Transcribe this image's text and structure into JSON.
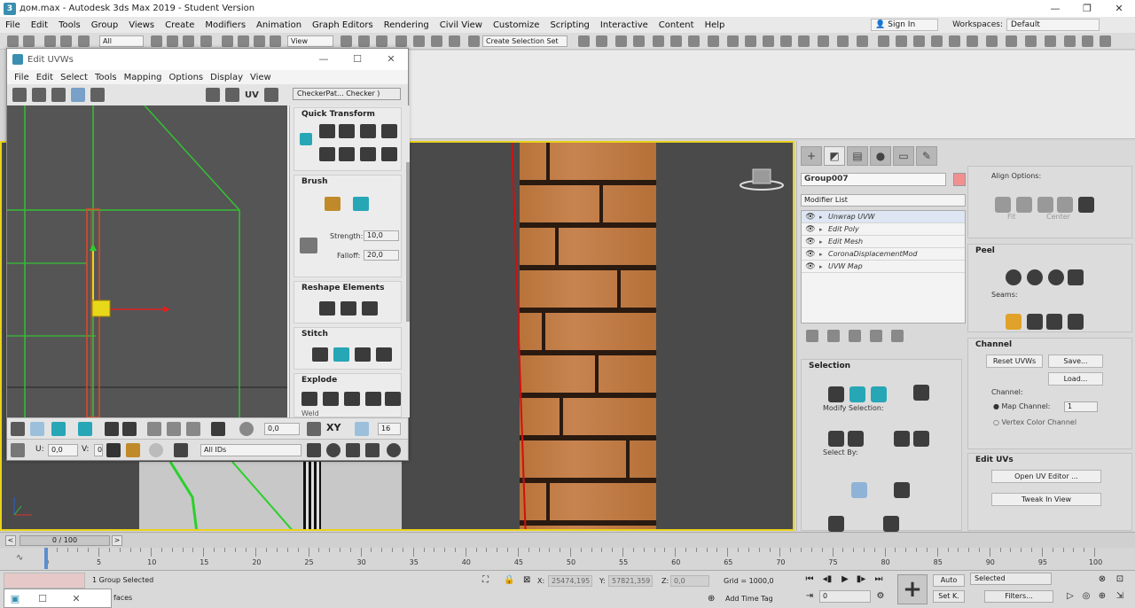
{
  "window": {
    "title": "дом.max - Autodesk 3ds Max 2019 - Student Version",
    "buttons": [
      "—",
      "❐",
      "✕"
    ]
  },
  "menubar": {
    "items": [
      "File",
      "Edit",
      "Tools",
      "Group",
      "Views",
      "Create",
      "Modifiers",
      "Animation",
      "Graph Editors",
      "Rendering",
      "Civil View",
      "Customize",
      "Scripting",
      "Interactive",
      "Content",
      "Help"
    ],
    "sign_in": "Sign In",
    "workspaces_label": "Workspaces:",
    "workspace_value": "Default"
  },
  "maintoolbar": {
    "filter": "All",
    "ref_coord": "View",
    "selection_set": "Create Selection Set"
  },
  "uvw_editor": {
    "title": "Edit UVWs",
    "menu": [
      "File",
      "Edit",
      "Select",
      "Tools",
      "Mapping",
      "Options",
      "Display",
      "View"
    ],
    "uv_label": "UV",
    "checker": "CheckerPat... Checker )",
    "sections": {
      "quick_transform": "Quick Transform",
      "brush": "Brush",
      "strength_label": "Strength:",
      "strength_value": "10,0",
      "falloff_label": "Falloff:",
      "falloff_value": "20,0",
      "reshape": "Reshape Elements",
      "stitch": "Stitch",
      "explode": "Explode",
      "weld": "Weld"
    },
    "bottom": {
      "angle_value": "0,0",
      "xy_label": "XY",
      "grid_value": "16",
      "u_label": "U:",
      "u_value": "0,0",
      "v_label": "V:",
      "v_value": "0",
      "ids": "All IDs"
    }
  },
  "cmdpanel": {
    "object_name": "Group007",
    "modifier_list": "Modifier List",
    "stack": [
      {
        "label": "Unwrap UVW",
        "selected": true
      },
      {
        "label": "Edit Poly",
        "selected": false
      },
      {
        "label": "Edit Mesh",
        "selected": false
      },
      {
        "label": "CoronaDisplacementMod",
        "selected": false
      },
      {
        "label": "UVW Map",
        "selected": false
      }
    ],
    "selection_title": "Selection",
    "modify_selection": "Modify Selection:",
    "select_by": "Select By:",
    "align_options": "Align Options:",
    "fit": "Fit",
    "center": "Center",
    "peel_title": "Peel",
    "seams": "Seams:",
    "channel_title": "Channel",
    "reset_uvws": "Reset UVWs",
    "save": "Save...",
    "load": "Load...",
    "channel_label": "Channel:",
    "map_channel": "Map Channel:",
    "map_channel_value": "1",
    "vertex_color_channel": "Vertex Color Channel",
    "edit_uvs_title": "Edit UVs",
    "open_uv_editor": "Open UV Editor ...",
    "tweak_in_view": "Tweak In View"
  },
  "timeline": {
    "frame": "0 / 100",
    "ticks": [
      "0",
      "5",
      "10",
      "15",
      "20",
      "25",
      "30",
      "35",
      "40",
      "45",
      "50",
      "55",
      "60",
      "65",
      "70",
      "75",
      "80",
      "85",
      "90",
      "95",
      "100"
    ]
  },
  "status": {
    "selected_text": "1 Group Selected",
    "faces_text": "faces",
    "x_label": "X:",
    "x_value": "25474,195",
    "y_label": "Y:",
    "y_value": "57821,359",
    "z_label": "Z:",
    "z_value": "0,0",
    "grid": "Grid = 1000,0",
    "add_time_tag": "Add Time Tag",
    "auto": "Auto",
    "set_k": "Set K.",
    "selected_dropdown": "Selected",
    "filters": "Filters...",
    "frame_value": "0"
  }
}
